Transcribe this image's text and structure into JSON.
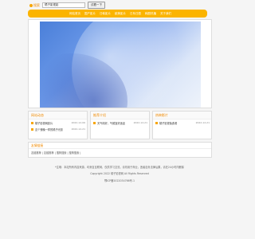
{
  "search": {
    "label": "搜索",
    "value": "橘子影视影",
    "button": "试看一下"
  },
  "nav": [
    "网站首页",
    "国产影片",
    "日韩影片",
    "欧美影片",
    "日系日剧",
    "韩剧热播",
    "关于我们"
  ],
  "columns": [
    {
      "title": "网站动态",
      "items": [
        {
          "text": "橘子影视网影片",
          "date": "2022-12-06"
        },
        {
          "text": "这个夜晚一样的橘子光影",
          "date": "2022-12-21"
        }
      ]
    },
    {
      "title": "推荐介绍",
      "items": [
        {
          "text": "天气晴好，气候宜好适逢",
          "date": "2022-12-21"
        }
      ]
    },
    {
      "title": "热映影片",
      "items": [
        {
          "text": "橘子影视免费看",
          "date": "2022-12-21"
        }
      ]
    }
  ],
  "links": {
    "title": "友情链接",
    "text": "友链推荐 | 友链推荐 | 搜狗搜索 | 搜狗搜索 |"
  },
  "footer": {
    "line1": "*注明：本站所有内容来源，均来自互联网，仅供学习交流，请勿用于商业，违者自负法律后果，请在24小时内删除",
    "line2": "Copyright 2022 橘子影视网 All Rights Reserved",
    "line3": "鄂ICP备2022034766号-1"
  }
}
